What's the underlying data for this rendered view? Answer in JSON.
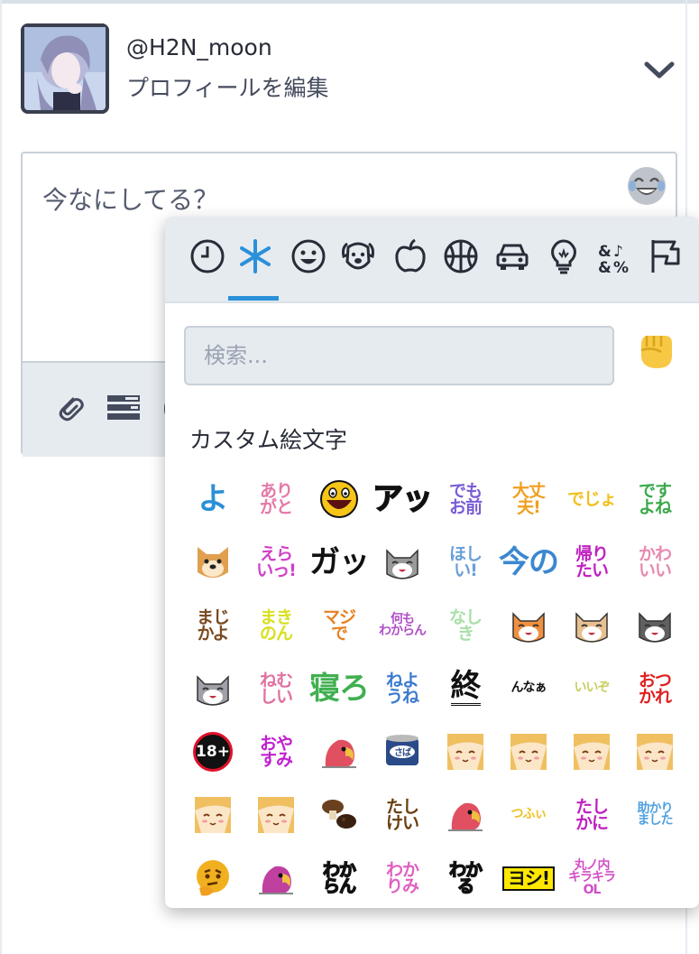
{
  "account": {
    "username": "@H2N_moon",
    "edit_profile_label": "プロフィールを編集"
  },
  "compose": {
    "placeholder": "今なにしてる？"
  },
  "emoji_picker": {
    "categories": [
      "recent-icon",
      "custom-icon",
      "smileys-icon",
      "animals-icon",
      "food-icon",
      "activity-icon",
      "travel-icon",
      "objects-icon",
      "symbols-icon",
      "flags-icon"
    ],
    "active_category": "custom-icon",
    "search_placeholder": "検索...",
    "section_title": "カスタム絵文字",
    "emojis": [
      {
        "text": "よ",
        "color": "#2a8fd8",
        "size": "t1"
      },
      {
        "text": "あり\nがと",
        "color": "#e47aa8",
        "size": "t2"
      },
      {
        "text": "awesome-face",
        "color": "#f5c518",
        "size": "face"
      },
      {
        "text": "アッ",
        "color": "#111111",
        "size": "t1",
        "style": "outlined"
      },
      {
        "text": "でも\nお前",
        "color": "#7a5cd6",
        "size": "t2"
      },
      {
        "text": "大丈\n夫!",
        "color": "#f0a020",
        "size": "t2"
      },
      {
        "text": "でじょ",
        "color": "#f0c020",
        "size": "t2"
      },
      {
        "text": "です\nよね",
        "color": "#3aa84a",
        "size": "t2"
      },
      {
        "text": "doge-face",
        "color": "#e0a050",
        "size": "face"
      },
      {
        "text": "えら\nいっ!",
        "color": "#d040c8",
        "size": "t2"
      },
      {
        "text": "ガッ",
        "color": "#111111",
        "size": "t1"
      },
      {
        "text": "cat-helmet",
        "color": "#9a9a9a",
        "size": "face"
      },
      {
        "text": "ほし\nい!",
        "color": "#6aa0d8",
        "size": "t2"
      },
      {
        "text": "今の",
        "color": "#3a88d0",
        "size": "t1"
      },
      {
        "text": "帰り\nたい",
        "color": "#c020c0",
        "size": "t2"
      },
      {
        "text": "かわ\nいい",
        "color": "#e88ab0",
        "size": "t2"
      },
      {
        "text": "まじ\nかよ",
        "color": "#7a4a20",
        "size": "t2"
      },
      {
        "text": "まき\nのん",
        "color": "#d8e020",
        "size": "t2"
      },
      {
        "text": "マジ\nで",
        "color": "#e88020",
        "size": "t2"
      },
      {
        "text": "何も\nわからん",
        "color": "#b050c8",
        "size": "t3"
      },
      {
        "text": "なし\nき",
        "color": "#a8e0a8",
        "size": "t2"
      },
      {
        "text": "cat-orange",
        "color": "#f09040",
        "size": "face"
      },
      {
        "text": "cat-calico",
        "color": "#e8c090",
        "size": "face"
      },
      {
        "text": "cat-tricolor",
        "color": "#606060",
        "size": "face"
      },
      {
        "text": "cat-gray",
        "color": "#a0a0a8",
        "size": "face"
      },
      {
        "text": "ねむ\nしい",
        "color": "#e070a0",
        "size": "t2"
      },
      {
        "text": "寝ろ",
        "color": "#40b050",
        "size": "t1"
      },
      {
        "text": "ねよ\nうね",
        "color": "#3a7ad0",
        "size": "t2"
      },
      {
        "text": "終",
        "color": "#111111",
        "size": "t1",
        "style": "underlined"
      },
      {
        "text": "んなぁ",
        "color": "#111111",
        "size": "t3"
      },
      {
        "text": "いいぞ",
        "color": "#c8d060",
        "size": "t3"
      },
      {
        "text": "おつ\nかれ",
        "color": "#e02020",
        "size": "t2"
      },
      {
        "text": "18+",
        "color": "#ffffff",
        "size": "circle18"
      },
      {
        "text": "おや\nすみ",
        "color": "#c020d0",
        "size": "t2"
      },
      {
        "text": "parrot-red",
        "color": "#e05060",
        "size": "face"
      },
      {
        "text": "さば",
        "color": "#2a4a88",
        "size": "face"
      },
      {
        "text": "fox-girl-1",
        "color": "#f0c060",
        "size": "face"
      },
      {
        "text": "fox-girl-2",
        "color": "#f0c060",
        "size": "face"
      },
      {
        "text": "fox-girl-3",
        "color": "#f0c060",
        "size": "face"
      },
      {
        "text": "fox-girl-4",
        "color": "#f0c060",
        "size": "face"
      },
      {
        "text": "fox-girl-5",
        "color": "#f0c060",
        "size": "face"
      },
      {
        "text": "fox-girl-6",
        "color": "#f0c060",
        "size": "face"
      },
      {
        "text": "mushroom",
        "color": "#6a4020",
        "size": "face"
      },
      {
        "text": "たし\nけい",
        "color": "#6a4010",
        "size": "t2"
      },
      {
        "text": "parrot-sleep",
        "color": "#e05060",
        "size": "face"
      },
      {
        "text": "つふぃ",
        "color": "#f0c020",
        "size": "t3"
      },
      {
        "text": "たし\nかに",
        "color": "#c020c0",
        "size": "t2"
      },
      {
        "text": "助かり\nました",
        "color": "#50a0e0",
        "size": "t3"
      },
      {
        "text": "thinking-face",
        "color": "#f0b020",
        "size": "face"
      },
      {
        "text": "parrot-purple",
        "color": "#c040a0",
        "size": "face"
      },
      {
        "text": "わか\nらん",
        "color": "#111111",
        "size": "t2",
        "style": "outlined"
      },
      {
        "text": "わか\nりみ",
        "color": "#e060c0",
        "size": "t2"
      },
      {
        "text": "わか\nる",
        "color": "#111111",
        "size": "t2",
        "style": "outlined"
      },
      {
        "text": "ヨシ!",
        "color": "#111111",
        "size": "box"
      },
      {
        "text": "丸ノ内\nキラキラ\nOL",
        "color": "#d050c8",
        "size": "t3"
      }
    ]
  },
  "colors": {
    "accent": "#2b90d9",
    "picker_bar": "#e6ebf0",
    "border": "#c8d0d9"
  }
}
